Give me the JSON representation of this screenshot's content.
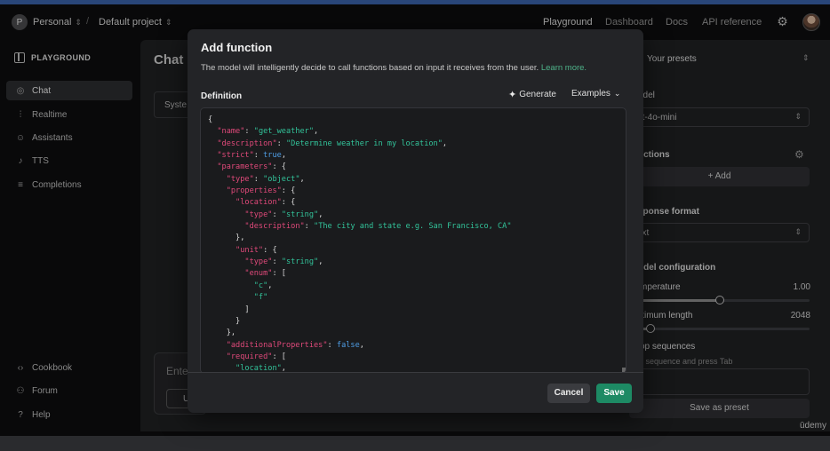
{
  "topnav": {
    "org_initial": "P",
    "org_name": "Personal",
    "separator": "/",
    "project_name": "Default project",
    "links": [
      "Playground",
      "Dashboard",
      "Docs",
      "API reference"
    ]
  },
  "sidebar": {
    "heading": "PLAYGROUND",
    "items": [
      {
        "label": "Chat",
        "icon": "chat-icon"
      },
      {
        "label": "Realtime",
        "icon": "waveform-icon"
      },
      {
        "label": "Assistants",
        "icon": "robot-icon"
      },
      {
        "label": "TTS",
        "icon": "microphone-icon"
      },
      {
        "label": "Completions",
        "icon": "lines-icon"
      }
    ],
    "footer_items": [
      {
        "label": "Cookbook",
        "icon": "code-icon"
      },
      {
        "label": "Forum",
        "icon": "people-icon"
      },
      {
        "label": "Help",
        "icon": "question-icon"
      }
    ]
  },
  "chat": {
    "title": "Chat",
    "system_partial": "Syste",
    "enter_partial": "Ente",
    "button_partial": "U"
  },
  "right_panel": {
    "presets": "Your presets",
    "model_label": "odel",
    "model_value": "pt-4o-mini",
    "functions_label": "nctions",
    "add_label": "+ Add",
    "response_label": "sponse format",
    "response_value": "ext",
    "config_label": "odel configuration",
    "temperature_label": "mperature",
    "temperature_value": "1.00",
    "temperature_fraction": 0.5,
    "maxlen_label": "ximum length",
    "maxlen_value": "2048",
    "maxlen_fraction": 0.12,
    "stop_label": "op sequences",
    "stop_hint": "er sequence and press Tab",
    "preset_button": "Save as preset"
  },
  "watermark": "ūdemy",
  "modal": {
    "title": "Add function",
    "description": "The model will intelligently decide to call functions based on input it receives from the user.",
    "learn_more": "Learn more.",
    "definition_label": "Definition",
    "generate_label": "Generate",
    "examples_label": "Examples",
    "cancel_label": "Cancel",
    "save_label": "Save",
    "code_lines": [
      [
        {
          "t": "p",
          "v": "{"
        }
      ],
      [
        {
          "t": "p",
          "v": "  "
        },
        {
          "t": "k",
          "v": "\"name\""
        },
        {
          "t": "p",
          "v": ": "
        },
        {
          "t": "s",
          "v": "\"get_weather\""
        },
        {
          "t": "p",
          "v": ","
        }
      ],
      [
        {
          "t": "p",
          "v": "  "
        },
        {
          "t": "k",
          "v": "\"description\""
        },
        {
          "t": "p",
          "v": ": "
        },
        {
          "t": "s",
          "v": "\"Determine weather in my location\""
        },
        {
          "t": "p",
          "v": ","
        }
      ],
      [
        {
          "t": "p",
          "v": "  "
        },
        {
          "t": "k",
          "v": "\"strict\""
        },
        {
          "t": "p",
          "v": ": "
        },
        {
          "t": "b",
          "v": "true"
        },
        {
          "t": "p",
          "v": ","
        }
      ],
      [
        {
          "t": "p",
          "v": "  "
        },
        {
          "t": "k",
          "v": "\"parameters\""
        },
        {
          "t": "p",
          "v": ": {"
        }
      ],
      [
        {
          "t": "p",
          "v": "    "
        },
        {
          "t": "k",
          "v": "\"type\""
        },
        {
          "t": "p",
          "v": ": "
        },
        {
          "t": "s",
          "v": "\"object\""
        },
        {
          "t": "p",
          "v": ","
        }
      ],
      [
        {
          "t": "p",
          "v": "    "
        },
        {
          "t": "k",
          "v": "\"properties\""
        },
        {
          "t": "p",
          "v": ": {"
        }
      ],
      [
        {
          "t": "p",
          "v": "      "
        },
        {
          "t": "k",
          "v": "\"location\""
        },
        {
          "t": "p",
          "v": ": {"
        }
      ],
      [
        {
          "t": "p",
          "v": "        "
        },
        {
          "t": "k",
          "v": "\"type\""
        },
        {
          "t": "p",
          "v": ": "
        },
        {
          "t": "s",
          "v": "\"string\""
        },
        {
          "t": "p",
          "v": ","
        }
      ],
      [
        {
          "t": "p",
          "v": "        "
        },
        {
          "t": "k",
          "v": "\"description\""
        },
        {
          "t": "p",
          "v": ": "
        },
        {
          "t": "s",
          "v": "\"The city and state e.g. San Francisco, CA\""
        }
      ],
      [
        {
          "t": "p",
          "v": "      },"
        }
      ],
      [
        {
          "t": "p",
          "v": "      "
        },
        {
          "t": "k",
          "v": "\"unit\""
        },
        {
          "t": "p",
          "v": ": {"
        }
      ],
      [
        {
          "t": "p",
          "v": "        "
        },
        {
          "t": "k",
          "v": "\"type\""
        },
        {
          "t": "p",
          "v": ": "
        },
        {
          "t": "s",
          "v": "\"string\""
        },
        {
          "t": "p",
          "v": ","
        }
      ],
      [
        {
          "t": "p",
          "v": "        "
        },
        {
          "t": "k",
          "v": "\"enum\""
        },
        {
          "t": "p",
          "v": ": ["
        }
      ],
      [
        {
          "t": "p",
          "v": "          "
        },
        {
          "t": "s",
          "v": "\"c\""
        },
        {
          "t": "p",
          "v": ","
        }
      ],
      [
        {
          "t": "p",
          "v": "          "
        },
        {
          "t": "s",
          "v": "\"f\""
        }
      ],
      [
        {
          "t": "p",
          "v": "        ]"
        }
      ],
      [
        {
          "t": "p",
          "v": "      }"
        }
      ],
      [
        {
          "t": "p",
          "v": "    },"
        }
      ],
      [
        {
          "t": "p",
          "v": "    "
        },
        {
          "t": "k",
          "v": "\"additionalProperties\""
        },
        {
          "t": "p",
          "v": ": "
        },
        {
          "t": "b",
          "v": "false"
        },
        {
          "t": "p",
          "v": ","
        }
      ],
      [
        {
          "t": "p",
          "v": "    "
        },
        {
          "t": "k",
          "v": "\"required\""
        },
        {
          "t": "p",
          "v": ": ["
        }
      ],
      [
        {
          "t": "p",
          "v": "      "
        },
        {
          "t": "s",
          "v": "\"location\""
        },
        {
          "t": "p",
          "v": ","
        }
      ]
    ]
  },
  "colors": {
    "accent": "#1d8a64",
    "link": "#4fb38a",
    "json_key": "#e0497a",
    "json_string": "#32c39a",
    "json_bool": "#4f9ee6"
  }
}
